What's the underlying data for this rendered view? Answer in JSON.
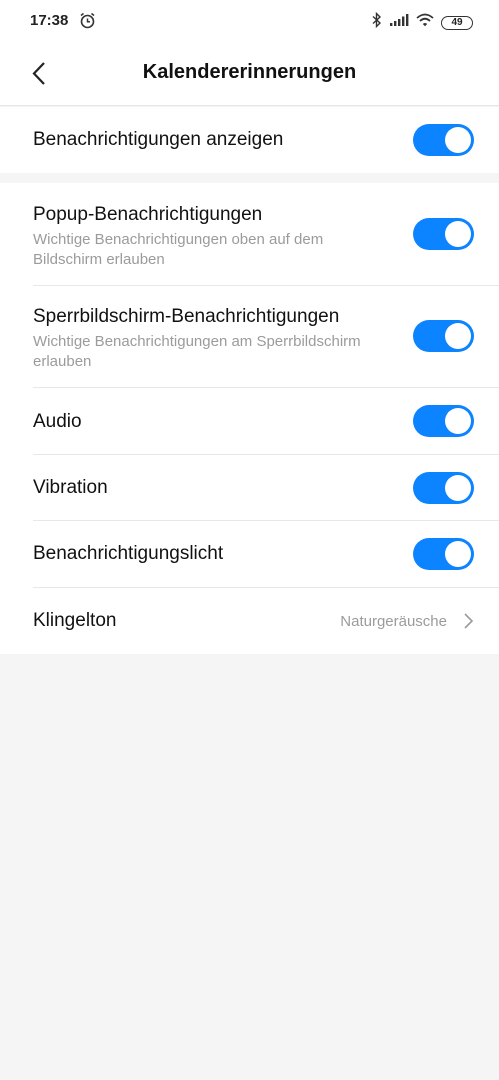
{
  "status_bar": {
    "time": "17:38",
    "battery": "49"
  },
  "header": {
    "title": "Kalendererinnerungen"
  },
  "settings": {
    "show_notifications": {
      "label": "Benachrichtigungen anzeigen",
      "enabled": true
    },
    "popup": {
      "label": "Popup-Benachrichtigungen",
      "description": "Wichtige Benachrichtigungen oben auf dem Bildschirm erlauben",
      "enabled": true
    },
    "lockscreen": {
      "label": "Sperrbildschirm-Benachrichtigungen",
      "description": "Wichtige Benachrichtigungen am Sperrbildschirm erlauben",
      "enabled": true
    },
    "audio": {
      "label": "Audio",
      "enabled": true
    },
    "vibration": {
      "label": "Vibration",
      "enabled": true
    },
    "light": {
      "label": "Benachrichtigungslicht",
      "enabled": true
    },
    "ringtone": {
      "label": "Klingelton",
      "value": "Naturgeräusche"
    }
  },
  "colors": {
    "accent": "#0d84ff",
    "background": "#f5f5f5"
  }
}
